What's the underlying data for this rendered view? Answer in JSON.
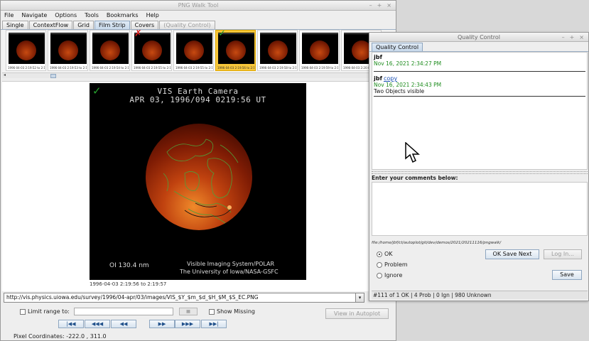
{
  "main_window": {
    "title": "PNG Walk Tool",
    "menu": [
      "File",
      "Navigate",
      "Options",
      "Tools",
      "Bookmarks",
      "Help"
    ],
    "tabs": [
      {
        "label": "Single",
        "state": "normal"
      },
      {
        "label": "ContextFlow",
        "state": "normal"
      },
      {
        "label": "Grid",
        "state": "normal"
      },
      {
        "label": "Film Strip",
        "state": "active"
      },
      {
        "label": "Covers",
        "state": "normal"
      },
      {
        "label": "(Quality Control)",
        "state": "disabled"
      }
    ],
    "thumbnails": [
      {
        "caption": "1996-04-03 2:19:52 to 2:19:52",
        "mark": "",
        "selected": false
      },
      {
        "caption": "1996-04-03 2:19:53 to 2:19:53",
        "mark": "",
        "selected": false
      },
      {
        "caption": "1996-04-03 2:19:54 to 2:19:54",
        "mark": "",
        "selected": false
      },
      {
        "caption": "1996-04-03 2:19:55 to 2:19:55",
        "mark": "✗",
        "selected": false
      },
      {
        "caption": "1996-04-03 2:19:55 to 2:19:55",
        "mark": "",
        "selected": false
      },
      {
        "caption": "1996-04-03 2:19:56 to 2:19:57",
        "mark": "✓",
        "selected": true
      },
      {
        "caption": "1996-04-03 2:19:58 to 2:19:58",
        "mark": "",
        "selected": false
      },
      {
        "caption": "1996-04-03 2:19:59 to 2:19:59",
        "mark": "",
        "selected": false
      },
      {
        "caption": "1996-04-03 2:20:00 to 2:20:00",
        "mark": "",
        "selected": false
      }
    ],
    "image": {
      "title": "VIS Earth Camera",
      "date_line": "APR 03, 1996/094 0219:56 UT",
      "filter": "OI  130.4 nm",
      "credit_line1": "Visible Imaging System/POLAR",
      "credit_line2": "The University of Iowa/NASA-GSFC",
      "caption": "1996-04-03 2:19:56 to 2:19:57"
    },
    "url": "http://vis.physics.uiowa.edu/survey/1996/04-apr/03/images/VIS_$Y_$m_$d_$H_$M_$S_EC.PNG",
    "limit_range_label": "Limit range to:",
    "show_missing_label": "Show Missing",
    "view_in_autoplot_label": "View in Autoplot",
    "nav_buttons": [
      "|◀◀",
      "◀◀◀",
      "◀◀",
      "▶▶",
      "▶▶▶",
      "▶▶|"
    ],
    "pixel_coordinates": "Pixel Coordinates: -222.0 , 311.0"
  },
  "qc_window": {
    "title": "Quality Control",
    "tab_label": "Quality Control",
    "comments": [
      {
        "user": "jbf",
        "link": "",
        "date": "Nov 16, 2021 2:34:27 PM",
        "text": ""
      },
      {
        "user": "jbf",
        "link": "copy",
        "date": "Nov 16, 2021 2:34:43 PM",
        "text": "Two Objects visible"
      }
    ],
    "enter_label": "Enter your comments below:",
    "file_path": "file:/home/jbf/ct/autoplot/git/dev/demos/2021/20211116/pngwalk/",
    "options": [
      {
        "label": "OK",
        "selected": true
      },
      {
        "label": "Problem",
        "selected": false
      },
      {
        "label": "Ignore",
        "selected": false
      }
    ],
    "ok_save_next_label": "OK Save Next",
    "log_in_label": "Log In...",
    "save_label": "Save",
    "status": "#111 of 1 OK | 4 Prob | 0 Ign | 980 Unknown"
  },
  "colors": {
    "accent_tab": "#c9daec",
    "selected_thumb": "#f7c63a",
    "comment_date": "#1d8c1d",
    "ok_mark": "#27a12f",
    "bad_mark": "#d81818"
  }
}
